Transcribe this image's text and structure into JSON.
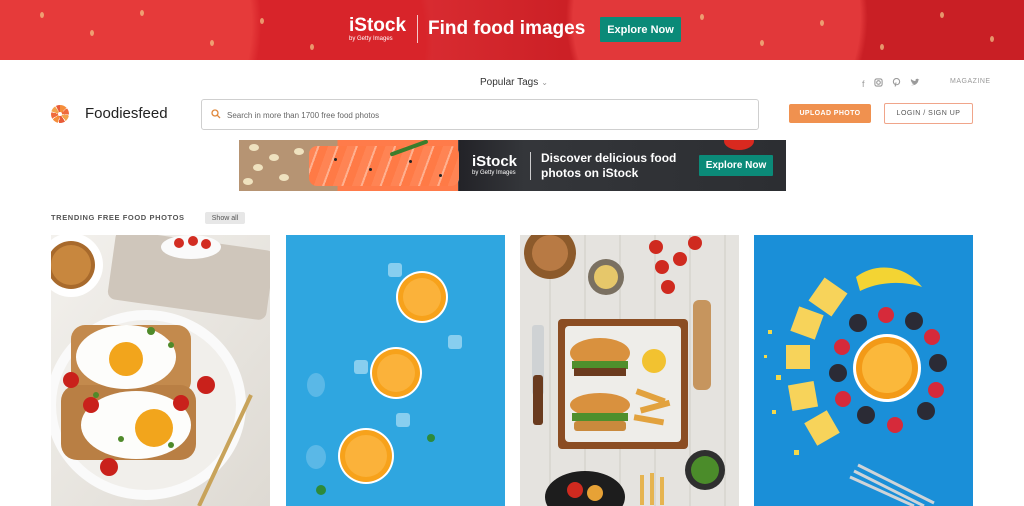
{
  "top_banner": {
    "brand": "iStock",
    "brand_sub": "by Getty Images",
    "headline": "Find food images",
    "cta": "Explore Now"
  },
  "header": {
    "popular_tags": "Popular Tags",
    "socials": [
      "f",
      "ig",
      "p",
      "tw"
    ],
    "magazine": "MAGAZINE",
    "brand_name": "Foodiesfeed",
    "search_placeholder": "Search in more than 1700 free food photos",
    "upload_label": "UPLOAD PHOTO",
    "login_label": "LOGIN / SIGN UP"
  },
  "mid_banner": {
    "brand": "iStock",
    "brand_sub": "by Getty Images",
    "headline_line1": "Discover delicious food",
    "headline_line2": "photos on iStock",
    "cta": "Explore Now"
  },
  "trending": {
    "title": "TRENDING FREE FOOD PHOTOS",
    "show_all": "Show all",
    "photos": [
      {
        "subject": "avocado toast with fried eggs"
      },
      {
        "subject": "orange slices on blue"
      },
      {
        "subject": "burgers with fries tray"
      },
      {
        "subject": "fruit circle on blue"
      }
    ]
  },
  "colors": {
    "upload_orange": "#f0914f",
    "istock_teal": "#0b8a78",
    "login_border": "#f0a58a"
  }
}
